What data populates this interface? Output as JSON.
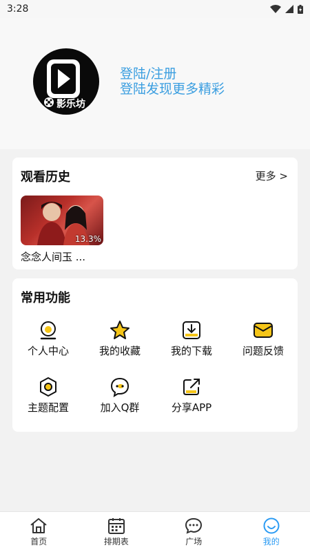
{
  "status_bar": {
    "time": "3:28"
  },
  "header": {
    "logo_text": "影乐坊",
    "login_label": "登陆/注册",
    "login_subtitle": "登陆发现更多精彩"
  },
  "history": {
    "title": "观看历史",
    "more_label": "更多 >",
    "items": [
      {
        "title": "念念人间玉 ...",
        "progress": "13.3%"
      }
    ]
  },
  "functions": {
    "title": "常用功能",
    "items": [
      {
        "label": "个人中心",
        "icon": "user-icon"
      },
      {
        "label": "我的收藏",
        "icon": "star-icon"
      },
      {
        "label": "我的下载",
        "icon": "download-icon"
      },
      {
        "label": "问题反馈",
        "icon": "mail-icon"
      },
      {
        "label": "主题配置",
        "icon": "theme-icon"
      },
      {
        "label": "加入Q群",
        "icon": "chat-group-icon"
      },
      {
        "label": "分享APP",
        "icon": "share-icon"
      }
    ]
  },
  "tabbar": {
    "items": [
      {
        "label": "首页",
        "icon": "home-icon"
      },
      {
        "label": "排期表",
        "icon": "calendar-icon"
      },
      {
        "label": "广场",
        "icon": "square-chat-icon"
      },
      {
        "label": "我的",
        "icon": "smiley-icon",
        "active": true
      }
    ],
    "active_color": "#2b9bf3"
  },
  "colors": {
    "accent_yellow": "#f5c518",
    "link_blue": "#3b9ee0"
  }
}
